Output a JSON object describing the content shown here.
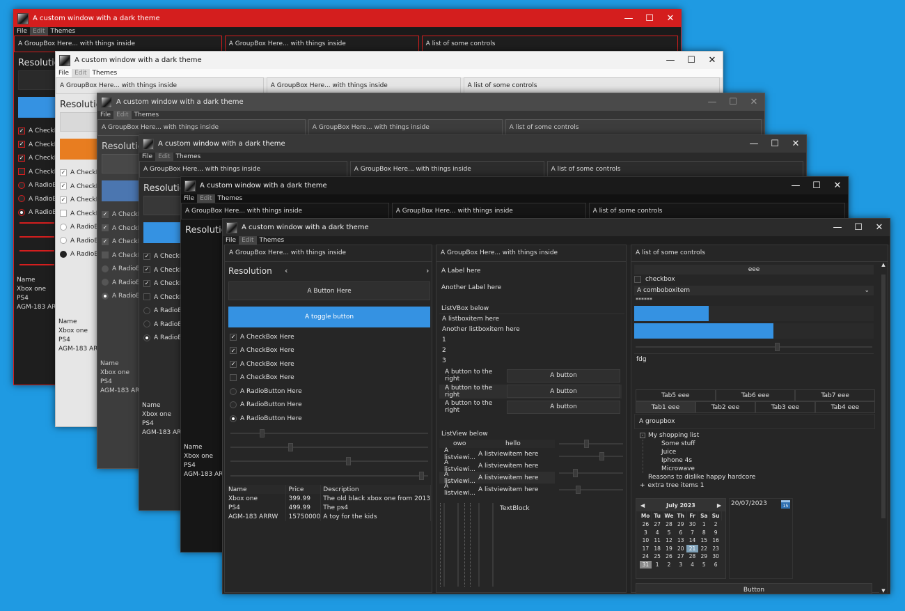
{
  "window_title": "A custom window with a dark theme",
  "menu": {
    "file": "File",
    "edit": "Edit",
    "themes": "Themes"
  },
  "titlebar": {
    "minimize": "—",
    "maximize": "☐",
    "close": "✕"
  },
  "groupboxes": {
    "g1": "A GroupBox Here... with things inside",
    "g2": "A GroupBox Here... with things inside",
    "g3": "A list of some controls"
  },
  "back": {
    "resolution": "Resolution",
    "checkbox_trunc": "A CheckB",
    "radio_trunc": "A RadioB",
    "lv_name": "Name",
    "lv_items": [
      "Xbox one",
      "PS4",
      "AGM-183 ARR"
    ]
  },
  "left": {
    "resolution": "Resolution",
    "prev": "‹",
    "next": "›",
    "button": "A Button Here",
    "toggle": "A toggle button",
    "checkboxes": [
      {
        "label": "A CheckBox Here",
        "checked": true
      },
      {
        "label": "A CheckBox Here",
        "checked": true
      },
      {
        "label": "A CheckBox Here",
        "checked": true
      },
      {
        "label": "A CheckBox Here",
        "checked": false
      }
    ],
    "radios": [
      {
        "label": "A RadioButton Here",
        "checked": false
      },
      {
        "label": "A RadioButton Here",
        "checked": false
      },
      {
        "label": "A RadioButton Here",
        "checked": true
      }
    ],
    "sliders": [
      0.15,
      0.3,
      0.6,
      0.98
    ],
    "table_headers": [
      "Name",
      "Price",
      "Description"
    ],
    "table_rows": [
      [
        "Xbox one",
        "399.99",
        "The old black xbox one from 2013"
      ],
      [
        "PS4",
        "499.99",
        "The ps4"
      ],
      [
        "AGM-183 ARRW",
        "15750000",
        "A toy for the kids"
      ]
    ]
  },
  "middle": {
    "label1": "A Label here",
    "label2": "Another Label here",
    "listvbox": "ListVBox below",
    "list_items": [
      "A listboxitem here",
      "Another listboxitem here",
      "1",
      "2",
      "3"
    ],
    "button_rows": [
      {
        "left": "A button to the right",
        "right": "A button"
      },
      {
        "left": "A button to the right",
        "right": "A button"
      },
      {
        "left": "A button to the right",
        "right": "A button"
      }
    ],
    "listview_label": "ListView below",
    "lv_headers": [
      "owo",
      "hello"
    ],
    "lv_rows": [
      [
        "A listviewi...",
        "A listviewitem here"
      ],
      [
        "A listviewi...",
        "A listviewitem here"
      ],
      [
        "A listviewi...",
        "A listviewitem here"
      ],
      [
        "A listviewi...",
        "A listviewitem here"
      ]
    ],
    "textblock": "TextBlock"
  },
  "right": {
    "textbox": "eee",
    "checkbox": "checkbox",
    "combo": "A comboboxitem",
    "combo_arrow": "⌄",
    "password": "******",
    "progress": [
      0.31,
      0.58
    ],
    "textarea": "fdg",
    "tabs_top": [
      "Tab5 eee",
      "Tab6 eee",
      "Tab7 eee"
    ],
    "tabs_bottom": [
      "Tab1 eee",
      "Tab2 eee",
      "Tab3 eee",
      "Tab4 eee"
    ],
    "groupbox": "A groupbox",
    "tree": {
      "root": "My shopping list",
      "children": [
        "Some stuff",
        "Juice",
        "Iphone 4s",
        "Microwave"
      ],
      "item2": "Reasons to dislike happy hardcore",
      "item3": "extra tree items 1",
      "collapse": "-",
      "expand": "+"
    },
    "calendar": {
      "month": "July 2023",
      "prev": "◀",
      "next": "▶",
      "days": [
        "Mo",
        "Tu",
        "We",
        "Th",
        "Fr",
        "Sa",
        "Su"
      ],
      "weeks": [
        [
          "26",
          "27",
          "28",
          "29",
          "30",
          "1",
          "2"
        ],
        [
          "3",
          "4",
          "5",
          "6",
          "7",
          "8",
          "9"
        ],
        [
          "10",
          "11",
          "12",
          "13",
          "14",
          "15",
          "16"
        ],
        [
          "17",
          "18",
          "19",
          "20",
          "21",
          "22",
          "23"
        ],
        [
          "24",
          "25",
          "26",
          "27",
          "28",
          "29",
          "30"
        ],
        [
          "31",
          "1",
          "2",
          "3",
          "4",
          "5",
          "6"
        ]
      ]
    },
    "date": "20/07/2023",
    "date_icon": "15",
    "bottom_button": "Button"
  },
  "colors": {
    "accent": "#3592e2",
    "red": "#d41e1e",
    "light": "#ececec",
    "orange": "#e87d20",
    "steel": "#4b76b0"
  }
}
